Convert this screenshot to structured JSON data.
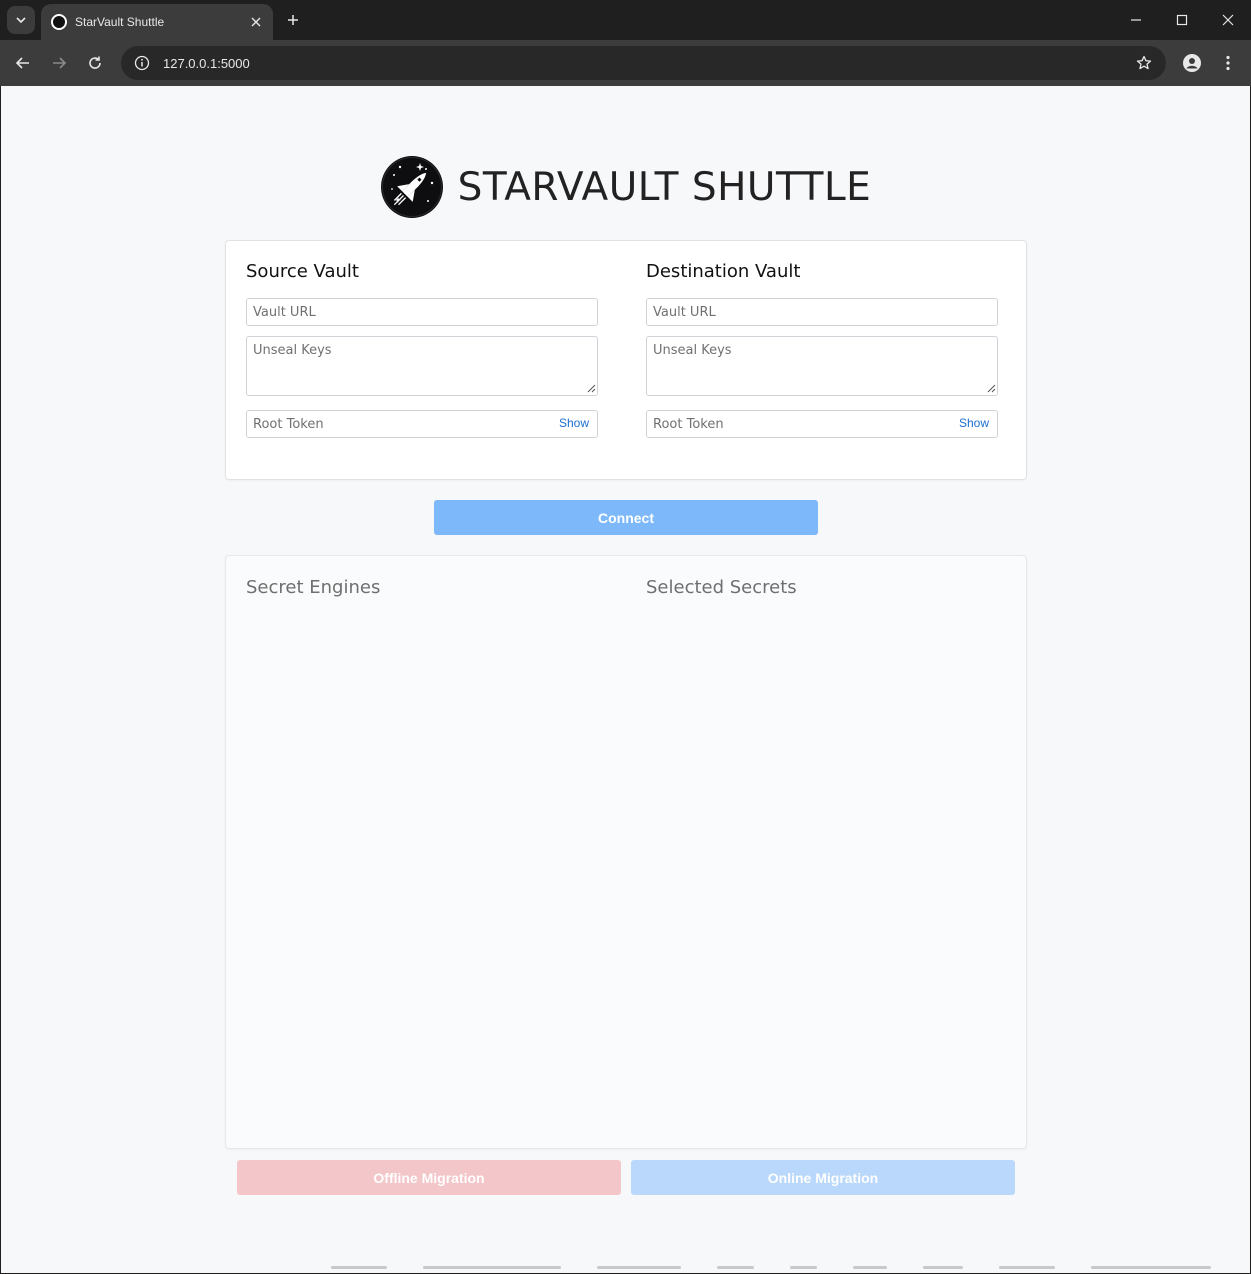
{
  "browser": {
    "tab_title": "StarVault Shuttle",
    "url": "127.0.0.1:5000"
  },
  "header": {
    "title": "STARVAULT SHUTTLE",
    "logo_icon": "space-shuttle-logo-icon"
  },
  "source_vault": {
    "title": "Source Vault",
    "url_placeholder": "Vault URL",
    "keys_placeholder": "Unseal Keys",
    "token_placeholder": "Root Token",
    "show_label": "Show"
  },
  "destination_vault": {
    "title": "Destination Vault",
    "url_placeholder": "Vault URL",
    "keys_placeholder": "Unseal Keys",
    "token_placeholder": "Root Token",
    "show_label": "Show"
  },
  "actions": {
    "connect_label": "Connect",
    "offline_label": "Offline Migration",
    "online_label": "Online Migration"
  },
  "secrets": {
    "engines_title": "Secret Engines",
    "selected_title": "Selected Secrets"
  },
  "colors": {
    "connect": "#7db8fb",
    "offline": "#f3c6ca",
    "online": "#b9d8fb",
    "link": "#1a6fd1"
  }
}
